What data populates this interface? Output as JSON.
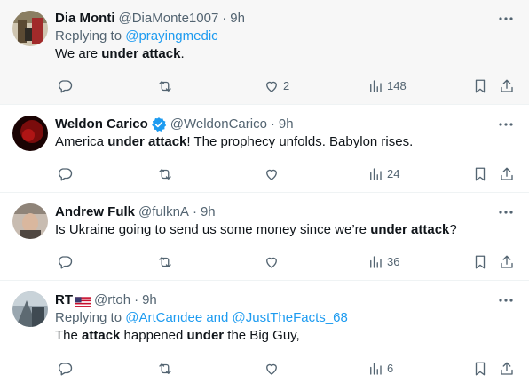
{
  "tweets": [
    {
      "name": "Dia Monti",
      "handle": "@DiaMonte1007",
      "time": "9h",
      "verified": false,
      "flag": false,
      "replying_prefix": "Replying to ",
      "replying_to": "@prayingmedic",
      "text": [
        {
          "t": "We are ",
          "b": false
        },
        {
          "t": "under attack",
          "b": true
        },
        {
          "t": ".",
          "b": false
        }
      ],
      "counts": {
        "replies": "",
        "retweets": "",
        "likes": "2",
        "views": "148"
      },
      "avatar_color": "#7a6a52"
    },
    {
      "name": "Weldon Carico",
      "handle": "@WeldonCarico",
      "time": "9h",
      "verified": true,
      "flag": false,
      "text": [
        {
          "t": "America ",
          "b": false
        },
        {
          "t": "under attack",
          "b": true
        },
        {
          "t": "! The prophecy unfolds. Babylon rises.",
          "b": false
        }
      ],
      "counts": {
        "replies": "",
        "retweets": "",
        "likes": "",
        "views": "24"
      },
      "avatar_color": "#5a0b0b"
    },
    {
      "name": "Andrew Fulk",
      "handle": "@fulknA",
      "time": "9h",
      "verified": false,
      "flag": false,
      "text": [
        {
          "t": "Is Ukraine going to send us some money since we’re ",
          "b": false
        },
        {
          "t": "under attack",
          "b": true
        },
        {
          "t": "?",
          "b": false
        }
      ],
      "counts": {
        "replies": "",
        "retweets": "",
        "likes": "",
        "views": "36"
      },
      "avatar_color": "#9c8f84"
    },
    {
      "name": "RT",
      "handle": "@rtoh",
      "time": "9h",
      "verified": false,
      "flag": true,
      "replying_prefix": "Replying to ",
      "replying_to": "@ArtCandee and @JustTheFacts_68",
      "text": [
        {
          "t": "The ",
          "b": false
        },
        {
          "t": "attack",
          "b": true
        },
        {
          "t": " happened ",
          "b": false
        },
        {
          "t": "under",
          "b": true
        },
        {
          "t": " the Big Guy,",
          "b": false
        }
      ],
      "counts": {
        "replies": "",
        "retweets": "",
        "likes": "",
        "views": "6"
      },
      "avatar_color": "#6d7b86"
    }
  ],
  "ui": {
    "dot": "·",
    "icons": [
      "reply-icon",
      "retweet-icon",
      "like-icon",
      "views-icon",
      "bookmark-icon",
      "share-icon",
      "more-icon",
      "verified-icon",
      "us-flag-icon"
    ],
    "colors": {
      "text": "#0f1419",
      "muted": "#536471",
      "link": "#1d9bf0",
      "verified": "#1d9bf0",
      "divider": "#eff3f4",
      "highlight_bg": "#f7f7f7"
    }
  }
}
